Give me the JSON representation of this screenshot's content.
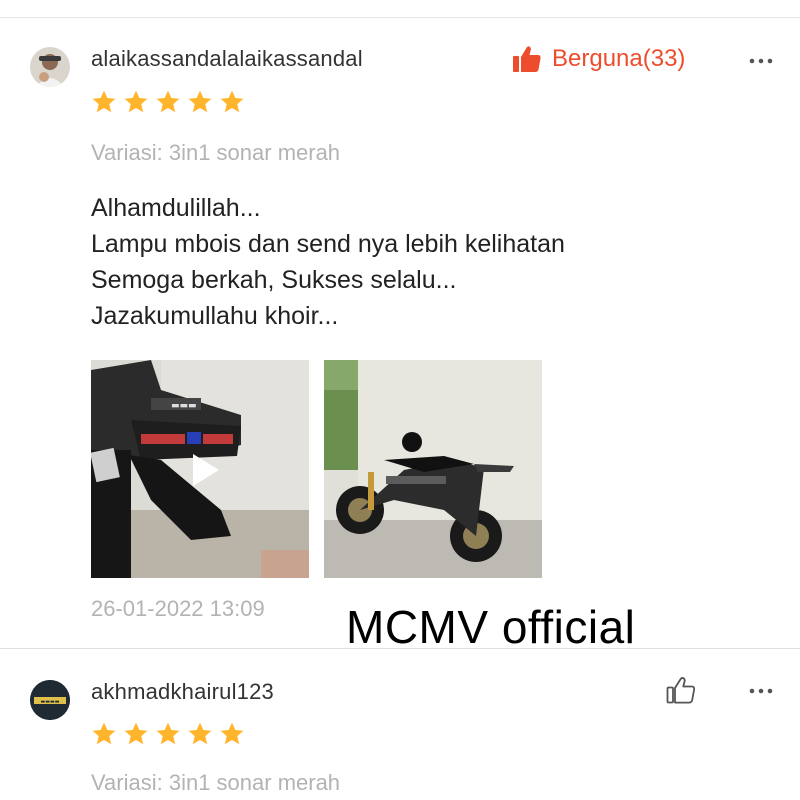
{
  "reviews": [
    {
      "username": "alaikassandalalaikassandal",
      "rating": 5,
      "helpful_label": "Berguna(33)",
      "variation": "Variasi: 3in1 sonar merah",
      "text_lines": [
        "Alhamdulillah...",
        "Lampu mbois dan send nya lebih kelihatan",
        "Semoga berkah, Sukses selalu...",
        "Jazakumullahu khoir..."
      ],
      "timestamp": "26-01-2022 13:09",
      "watermark": "MCMV official",
      "media": [
        {
          "type": "video",
          "icon": "play-icon"
        },
        {
          "type": "photo"
        }
      ]
    },
    {
      "username": "akhmadkhairul123",
      "rating": 5,
      "variation": "Variasi: 3in1 sonar merah"
    }
  ],
  "colors": {
    "accent": "#ee4d2d",
    "star": "#ffb52b",
    "muted_text": "#b3b3b3"
  },
  "icons": {
    "helpful_active": "thumbs-up-filled-icon",
    "helpful_inactive": "thumbs-up-outline-icon",
    "more": "more-dots-icon"
  }
}
